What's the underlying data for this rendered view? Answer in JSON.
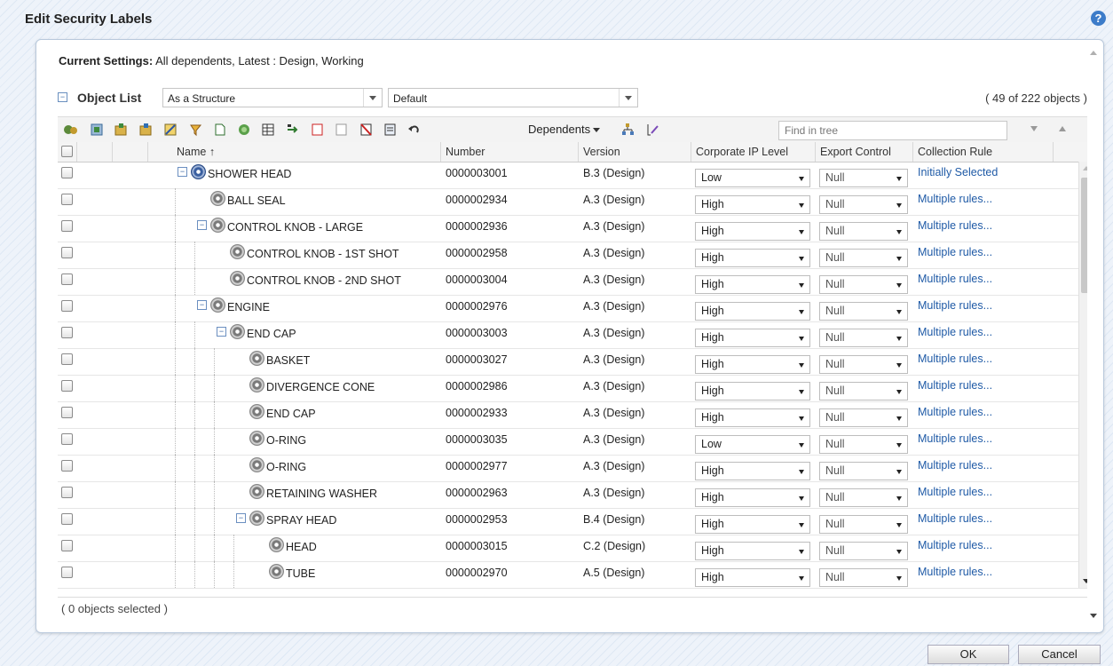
{
  "dialog": {
    "title": "Edit Security Labels",
    "help_icon": "?"
  },
  "settings": {
    "label": "Current Settings:",
    "value": "All dependents, Latest : Design, Working"
  },
  "object_list": {
    "title": "Object List",
    "view_select": "As a Structure",
    "filter_select": "Default",
    "count": "( 49 of 222 objects )"
  },
  "toolbar": {
    "dependents_label": "Dependents",
    "find_placeholder": "Find in tree"
  },
  "columns": {
    "name": "Name",
    "sort_indicator": "↑",
    "number": "Number",
    "version": "Version",
    "ip": "Corporate IP Level",
    "export": "Export Control",
    "rule": "Collection Rule"
  },
  "rows": [
    {
      "name": "SHOWER HEAD",
      "number": "0000003001",
      "version": "B.3 (Design)",
      "ip": "Low",
      "export": "Null",
      "rule": "Initially Selected"
    },
    {
      "name": "BALL SEAL",
      "number": "0000002934",
      "version": "A.3 (Design)",
      "ip": "High",
      "export": "Null",
      "rule": "Multiple rules..."
    },
    {
      "name": "CONTROL KNOB - LARGE",
      "number": "0000002936",
      "version": "A.3 (Design)",
      "ip": "High",
      "export": "Null",
      "rule": "Multiple rules..."
    },
    {
      "name": "CONTROL KNOB - 1ST SHOT",
      "number": "0000002958",
      "version": "A.3 (Design)",
      "ip": "High",
      "export": "Null",
      "rule": "Multiple rules..."
    },
    {
      "name": "CONTROL KNOB - 2ND SHOT",
      "number": "0000003004",
      "version": "A.3 (Design)",
      "ip": "High",
      "export": "Null",
      "rule": "Multiple rules..."
    },
    {
      "name": "ENGINE",
      "number": "0000002976",
      "version": "A.3 (Design)",
      "ip": "High",
      "export": "Null",
      "rule": "Multiple rules..."
    },
    {
      "name": "END CAP",
      "number": "0000003003",
      "version": "A.3 (Design)",
      "ip": "High",
      "export": "Null",
      "rule": "Multiple rules..."
    },
    {
      "name": "BASKET",
      "number": "0000003027",
      "version": "A.3 (Design)",
      "ip": "High",
      "export": "Null",
      "rule": "Multiple rules..."
    },
    {
      "name": "DIVERGENCE CONE",
      "number": "0000002986",
      "version": "A.3 (Design)",
      "ip": "High",
      "export": "Null",
      "rule": "Multiple rules..."
    },
    {
      "name": "END CAP",
      "number": "0000002933",
      "version": "A.3 (Design)",
      "ip": "High",
      "export": "Null",
      "rule": "Multiple rules..."
    },
    {
      "name": "O-RING",
      "number": "0000003035",
      "version": "A.3 (Design)",
      "ip": "Low",
      "export": "Null",
      "rule": "Multiple rules..."
    },
    {
      "name": "O-RING",
      "number": "0000002977",
      "version": "A.3 (Design)",
      "ip": "High",
      "export": "Null",
      "rule": "Multiple rules..."
    },
    {
      "name": "RETAINING WASHER",
      "number": "0000002963",
      "version": "A.3 (Design)",
      "ip": "High",
      "export": "Null",
      "rule": "Multiple rules..."
    },
    {
      "name": "SPRAY HEAD",
      "number": "0000002953",
      "version": "B.4 (Design)",
      "ip": "High",
      "export": "Null",
      "rule": "Multiple rules..."
    },
    {
      "name": "HEAD",
      "number": "0000003015",
      "version": "C.2 (Design)",
      "ip": "High",
      "export": "Null",
      "rule": "Multiple rules..."
    },
    {
      "name": "TUBE",
      "number": "0000002970",
      "version": "A.5 (Design)",
      "ip": "High",
      "export": "Null",
      "rule": "Multiple rules..."
    }
  ],
  "status": "( 0 objects selected )",
  "buttons": {
    "ok": "OK",
    "cancel": "Cancel"
  },
  "colors": {
    "link": "#1f5aa6",
    "accent": "#3d7cc9"
  }
}
